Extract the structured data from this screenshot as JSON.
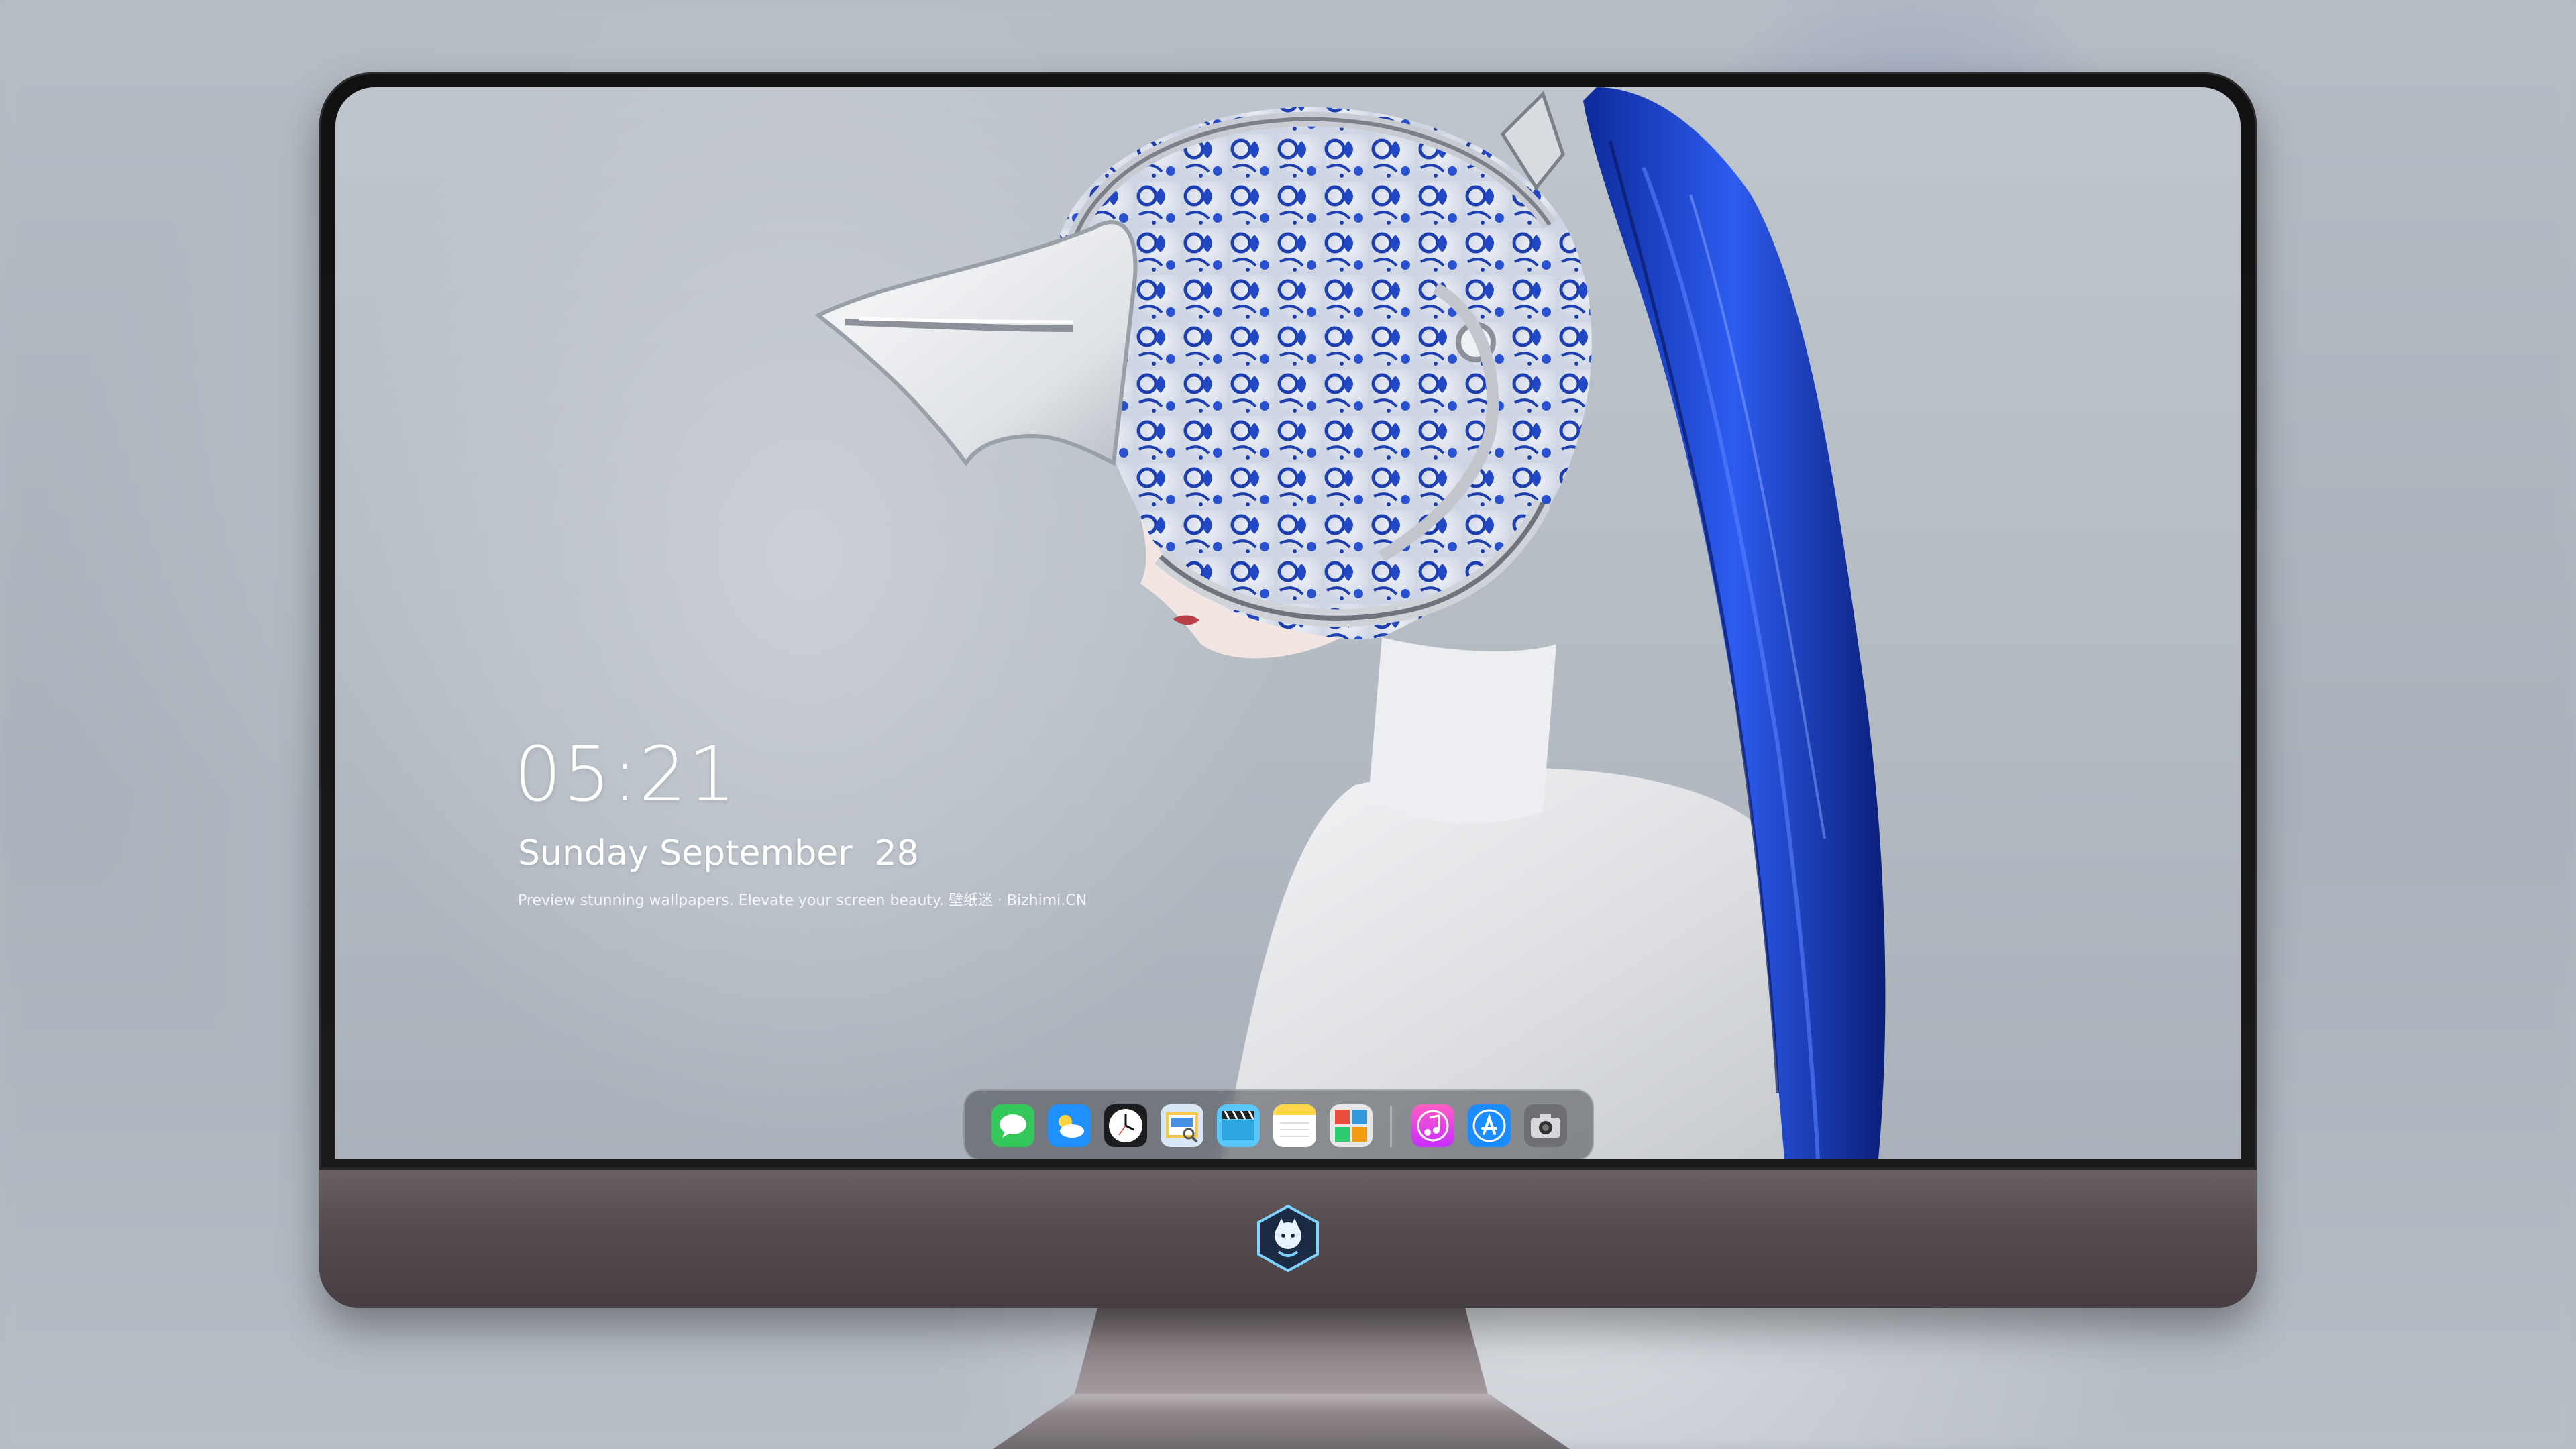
{
  "lock_screen": {
    "time": "05:21",
    "weekday": "Sunday",
    "month": "September",
    "day": "28",
    "tagline": "Preview stunning wallpapers. Elevate your screen beauty. 壁纸迷 · Bizhimi.CN"
  },
  "dock": {
    "apps": [
      {
        "name": "Messages",
        "icon": "messages-icon",
        "color": "#34c759"
      },
      {
        "name": "Weather",
        "icon": "weather-icon",
        "color": "#1e90ff"
      },
      {
        "name": "Clock",
        "icon": "clock-icon",
        "color": "#1c1c1e"
      },
      {
        "name": "Preview",
        "icon": "preview-icon",
        "color": "#f2c94c"
      },
      {
        "name": "Clips",
        "icon": "clips-icon",
        "color": "#5ac8fa"
      },
      {
        "name": "Notes",
        "icon": "notes-icon",
        "color": "#ffd54a"
      },
      {
        "name": "Photo Booth",
        "icon": "photo-booth-icon",
        "color": "#e8e8e8"
      },
      {
        "name": "Music",
        "icon": "music-icon",
        "color": "#ff2d95"
      },
      {
        "name": "App Store",
        "icon": "app-store-icon",
        "color": "#1a8cff"
      },
      {
        "name": "Camera",
        "icon": "camera-icon",
        "color": "#6e6e73"
      }
    ]
  },
  "colors": {
    "hair_blue": "#1f4fd6",
    "porcelain_blue": "#1d3fb0",
    "chin": "#554c50"
  }
}
